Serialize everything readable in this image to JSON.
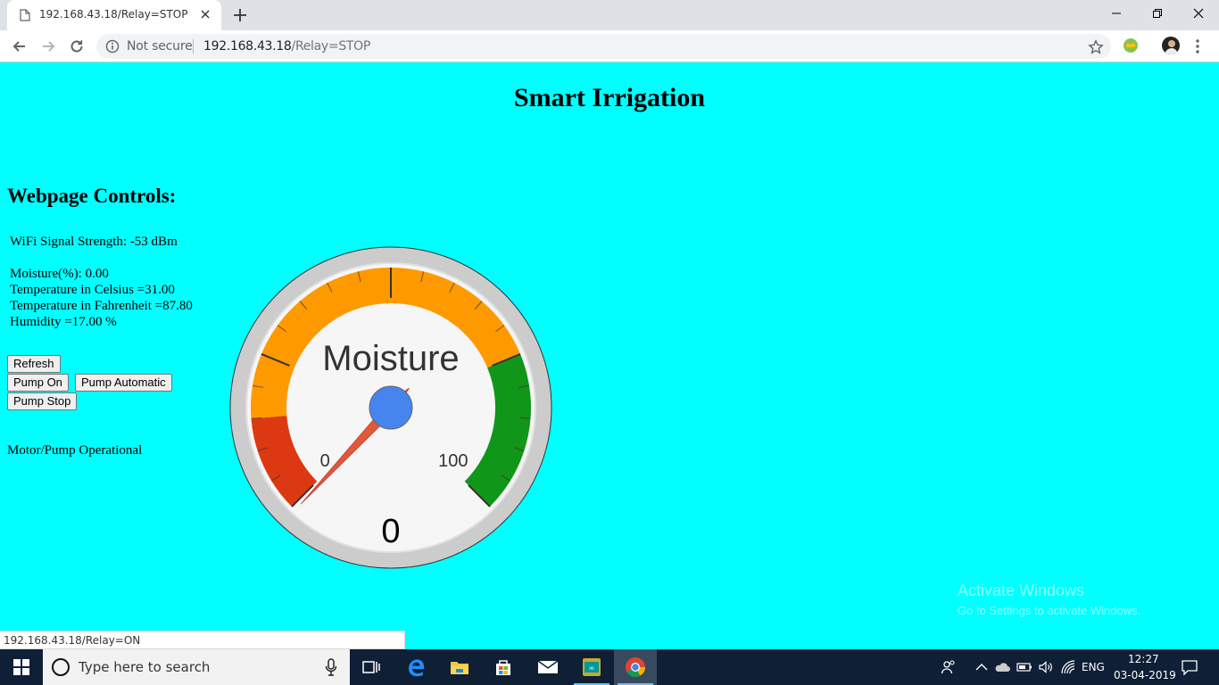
{
  "browser": {
    "tab_title": "192.168.43.18/Relay=STOP",
    "security_label": "Not secure",
    "url_host": "192.168.43.18",
    "url_path": "/Relay=STOP",
    "hover_status_url": "192.168.43.18/Relay=ON"
  },
  "page": {
    "title": "Smart Irrigation",
    "controls_heading": "Webpage Controls:",
    "wifi_signal": "WiFi Signal Strength: -53 dBm",
    "moisture": "Moisture(%): 0.00",
    "temp_c": "Temperature in Celsius =31.00",
    "temp_f": "Temperature in Fahrenheit =87.80",
    "humidity": "Humidity =17.00 %",
    "buttons": {
      "refresh": "Refresh",
      "pump_on": "Pump On",
      "pump_automatic": "Pump Automatic",
      "pump_stop": "Pump Stop"
    },
    "status": "Motor/Pump Operational"
  },
  "gauge": {
    "label": "Moisture",
    "value": 0,
    "value_text": "0",
    "min": 0,
    "max": 100,
    "min_label": "0",
    "max_label": "100",
    "bands": [
      {
        "from": 0,
        "to": 15,
        "color": "#dc3912"
      },
      {
        "from": 15,
        "to": 75,
        "color": "#ff9900"
      },
      {
        "from": 75,
        "to": 100,
        "color": "#109618"
      }
    ],
    "needle_color": "#e05a3a",
    "hub_color": "#4684ee"
  },
  "watermark": {
    "line1": "Activate Windows",
    "line2": "Go to Settings to activate Windows."
  },
  "taskbar": {
    "search_placeholder": "Type here to search",
    "language": "ENG",
    "time": "12:27",
    "date": "03-04-2019"
  }
}
